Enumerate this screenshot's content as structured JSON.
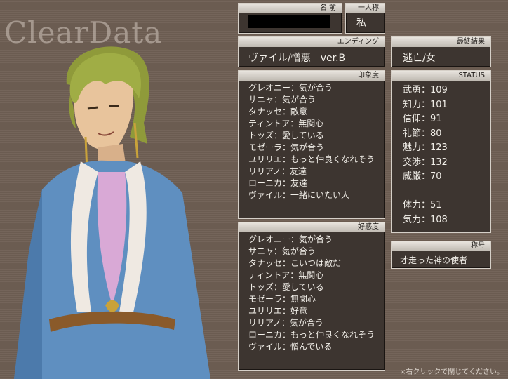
{
  "logo": "ClearData",
  "name_panel": {
    "label": "名 前",
    "value": ""
  },
  "pronoun_panel": {
    "label": "一人称",
    "value": "私"
  },
  "ending_panel": {
    "label": "エンディング",
    "value": "ヴァイル/憎悪　ver.B"
  },
  "final_panel": {
    "label": "最終結果",
    "value": "逃亡/女"
  },
  "impression_panel": {
    "label": "印象度",
    "items": [
      "グレオニー：気が合う",
      "サニャ：気が合う",
      "タナッセ：敵意",
      "ティントア：無関心",
      "トッズ：愛している",
      "モゼーラ：気が合う",
      "ユリリエ：もっと仲良くなれそう",
      "リリアノ：友達",
      "ローニカ：友達",
      "ヴァイル：一緒にいたい人"
    ]
  },
  "favor_panel": {
    "label": "好感度",
    "items": [
      "グレオニー：気が合う",
      "サニャ：気が合う",
      "タナッセ：こいつは敵だ",
      "ティントア：無関心",
      "トッズ：愛している",
      "モゼーラ：無関心",
      "ユリリエ：好意",
      "リリアノ：気が合う",
      "ローニカ：もっと仲良くなれそう",
      "ヴァイル：憎んでいる"
    ]
  },
  "status_panel": {
    "label": "STATUS",
    "stats": [
      "武勇：109",
      "知力：101",
      "信仰：91",
      "礼節：80",
      "魅力：123",
      "交渉：132",
      "威厳：70",
      "",
      "体力：51",
      "気力：108"
    ]
  },
  "title_panel": {
    "label": "称号",
    "value": "才走った神の使者"
  },
  "hint": "×右クリックで閉じてください。",
  "colors": {
    "panel_bg": "#3d3530",
    "background": "#6f5f54",
    "header": "#cfc9c1"
  }
}
